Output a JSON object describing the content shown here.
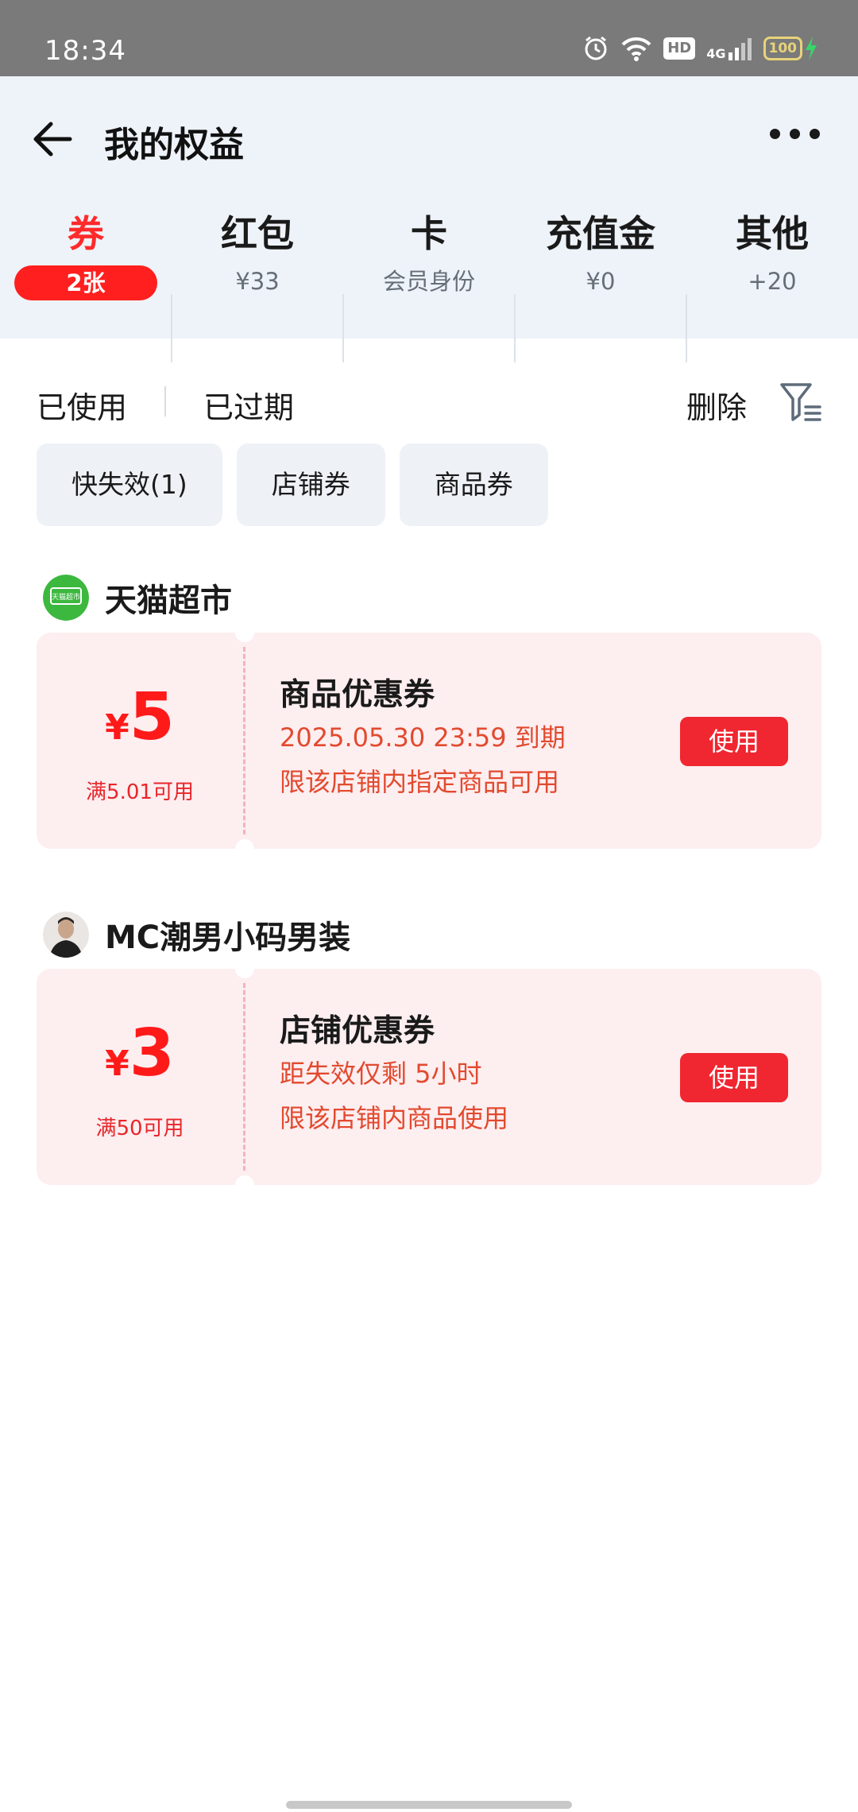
{
  "status_bar": {
    "time": "18:34",
    "hd": "HD",
    "network": "4G",
    "battery": "100"
  },
  "header": {
    "title": "我的权益"
  },
  "categories": [
    {
      "label": "券",
      "sub": "2张",
      "active": true
    },
    {
      "label": "红包",
      "sub": "¥33"
    },
    {
      "label": "卡",
      "sub": "会员身份"
    },
    {
      "label": "充值金",
      "sub": "¥0"
    },
    {
      "label": "其他",
      "sub": "+20"
    }
  ],
  "filters": {
    "used": "已使用",
    "expired": "已过期",
    "delete": "删除"
  },
  "chips": [
    "快失效(1)",
    "店铺券",
    "商品券"
  ],
  "stores": [
    {
      "name": "天猫超市",
      "logo_text": "天猫超市",
      "coupon": {
        "currency": "¥",
        "amount": "5",
        "condition": "满5.01可用",
        "title": "商品优惠券",
        "line1": "2025.05.30 23:59 到期",
        "line2": "限该店铺内指定商品可用",
        "button": "使用"
      }
    },
    {
      "name": "MC潮男小码男装",
      "coupon": {
        "currency": "¥",
        "amount": "3",
        "condition": "满50可用",
        "title": "店铺优惠券",
        "line1": "距失效仅剩 5小时",
        "line2": "限该店铺内商品使用",
        "button": "使用"
      }
    }
  ],
  "colors": {
    "accent": "#ff1f1f",
    "header_bg": "#eef3f9",
    "coupon_bg": "#fdeef0"
  }
}
